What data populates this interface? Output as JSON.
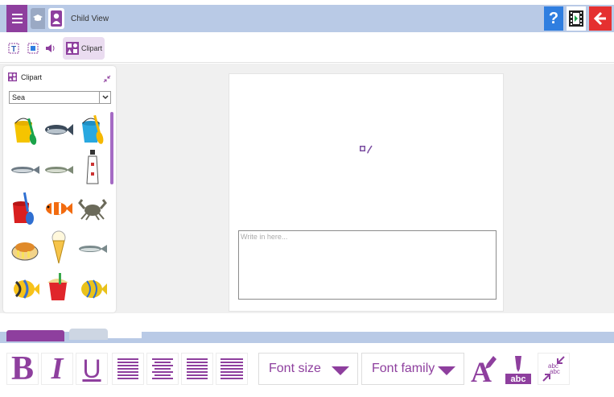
{
  "topbar": {
    "view_label": "Child View",
    "colors": {
      "bar": "#b9cae6",
      "menu": "#8e3f9e",
      "help": "#2f7ee0",
      "back": "#e53030"
    },
    "icons": [
      "menu-icon",
      "graduation-cap-icon",
      "child-user-icon",
      "help-icon",
      "film-play-icon",
      "back-arrow-icon"
    ]
  },
  "toolbar": {
    "clipart_label": "Clipart",
    "icons": [
      "text-box-icon",
      "image-box-icon",
      "speaker-icon",
      "clipart-icon"
    ]
  },
  "clipart_panel": {
    "title": "Clipart",
    "category": "Sea",
    "items": [
      "bucket-spade-icon",
      "fish-icon",
      "bucket-spade-icon",
      "fish-icon",
      "fish-icon",
      "lighthouse-icon",
      "bucket-spade-icon",
      "clownfish-icon",
      "crab-icon",
      "fish-and-chips-icon",
      "ice-cream-icon",
      "fish-icon",
      "tropical-fish-icon",
      "sand-bucket-icon",
      "tropical-fish-icon"
    ]
  },
  "page": {
    "write_placeholder": "Write in here..."
  },
  "format_toolbar": {
    "bold": "B",
    "italic": "I",
    "underline": "U",
    "font_size_label": "Font size",
    "font_family_label": "Font family",
    "accent_color": "#8e3f9e"
  }
}
